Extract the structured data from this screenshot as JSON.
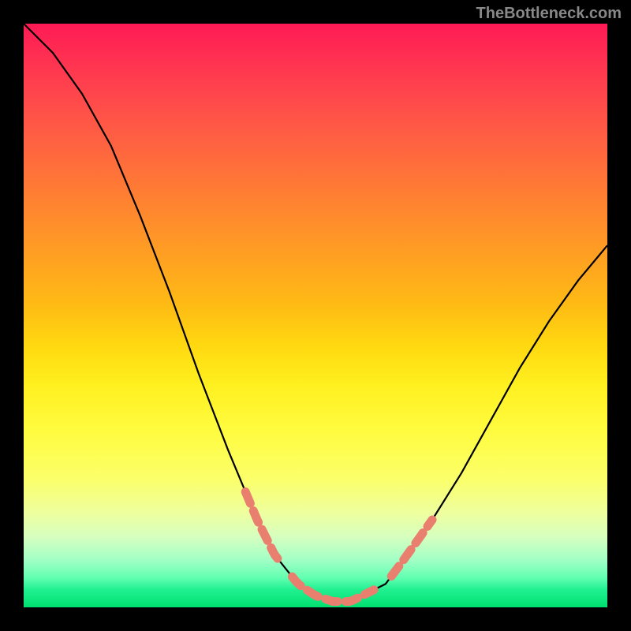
{
  "watermark": "TheBottleneck.com",
  "chart_data": {
    "type": "line",
    "title": "",
    "xlabel": "",
    "ylabel": "",
    "xlim": [
      0,
      100
    ],
    "ylim": [
      0,
      100
    ],
    "series": [
      {
        "name": "curve",
        "x": [
          0,
          5,
          10,
          15,
          20,
          25,
          30,
          35,
          40,
          43,
          47,
          50,
          53,
          56,
          58,
          62,
          65,
          70,
          75,
          80,
          85,
          90,
          95,
          100
        ],
        "y": [
          100,
          95,
          88,
          79,
          67,
          54,
          40,
          27,
          15,
          9,
          4,
          2,
          1,
          1,
          2,
          4,
          8,
          15,
          23,
          32,
          41,
          49,
          56,
          62
        ]
      }
    ],
    "highlighted_segments": [
      {
        "x_start": 38,
        "x_end": 44
      },
      {
        "x_start": 46,
        "x_end": 60
      },
      {
        "x_start": 63,
        "x_end": 70
      }
    ],
    "gradient_stops": [
      {
        "pct": 0,
        "color": "#ff1a55"
      },
      {
        "pct": 50,
        "color": "#ffd810"
      },
      {
        "pct": 75,
        "color": "#fbff6a"
      },
      {
        "pct": 100,
        "color": "#00e070"
      }
    ]
  }
}
